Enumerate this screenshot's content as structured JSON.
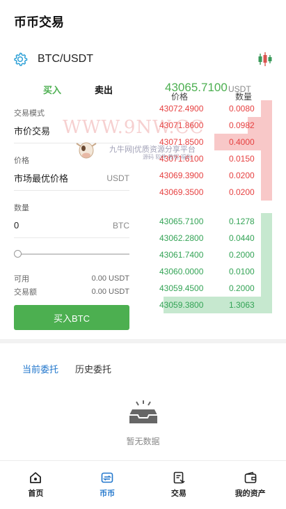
{
  "header": {
    "title": "币币交易"
  },
  "pair": {
    "name": "BTC/USDT"
  },
  "trade": {
    "buy_tab": "买入",
    "sell_tab": "卖出",
    "last_price": "43065.7100",
    "last_price_unit": "USDT"
  },
  "form": {
    "mode_label": "交易模式",
    "mode_value": "市价交易",
    "price_label": "价格",
    "price_value": "市场最优价格",
    "price_unit": "USDT",
    "qty_label": "数量",
    "qty_value": "0",
    "qty_unit": "BTC",
    "slider_value": 0,
    "available_label": "可用",
    "available_value": "0.00 USDT",
    "amount_label": "交易额",
    "amount_value": "0.00 USDT",
    "submit_label": "买入BTC"
  },
  "orderbook": {
    "price_header": "价格",
    "qty_header": "数量",
    "asks": [
      {
        "price": "43072.4900",
        "qty": "0.0080",
        "depth": 0.09
      },
      {
        "price": "43071.8600",
        "qty": "0.0982",
        "depth": 0.2
      },
      {
        "price": "43071.8500",
        "qty": "0.4000",
        "depth": 0.48
      },
      {
        "price": "43071.6100",
        "qty": "0.0150",
        "depth": 0.09
      },
      {
        "price": "43069.3900",
        "qty": "0.0200",
        "depth": 0.09
      },
      {
        "price": "43069.3500",
        "qty": "0.0200",
        "depth": 0.09
      }
    ],
    "bids": [
      {
        "price": "43065.7100",
        "qty": "0.1278",
        "depth": 0.09
      },
      {
        "price": "43062.2800",
        "qty": "0.0440",
        "depth": 0.09
      },
      {
        "price": "43061.7400",
        "qty": "0.2000",
        "depth": 0.09
      },
      {
        "price": "43060.0000",
        "qty": "0.0100",
        "depth": 0.09
      },
      {
        "price": "43059.4500",
        "qty": "0.2000",
        "depth": 0.09
      },
      {
        "price": "43059.3800",
        "qty": "1.3063",
        "depth": 0.9
      }
    ]
  },
  "orders": {
    "current_tab": "当前委托",
    "history_tab": "历史委托",
    "empty_text": "暂无数据"
  },
  "nav": {
    "items": [
      {
        "label": "首页",
        "icon": "home-icon"
      },
      {
        "label": "币币",
        "icon": "wallet-swap-icon"
      },
      {
        "label": "交易",
        "icon": "document-icon"
      },
      {
        "label": "我的资产",
        "icon": "wallet-icon"
      }
    ],
    "active": 1
  },
  "watermark": {
    "text": "WWW.9NW.CC",
    "sub": "九牛网|优质资源分享平台",
    "sub2": "源码 软件 教程 福利"
  },
  "colors": {
    "buy": "#4caf50",
    "sell": "#e64040",
    "accent": "#2277cc"
  }
}
